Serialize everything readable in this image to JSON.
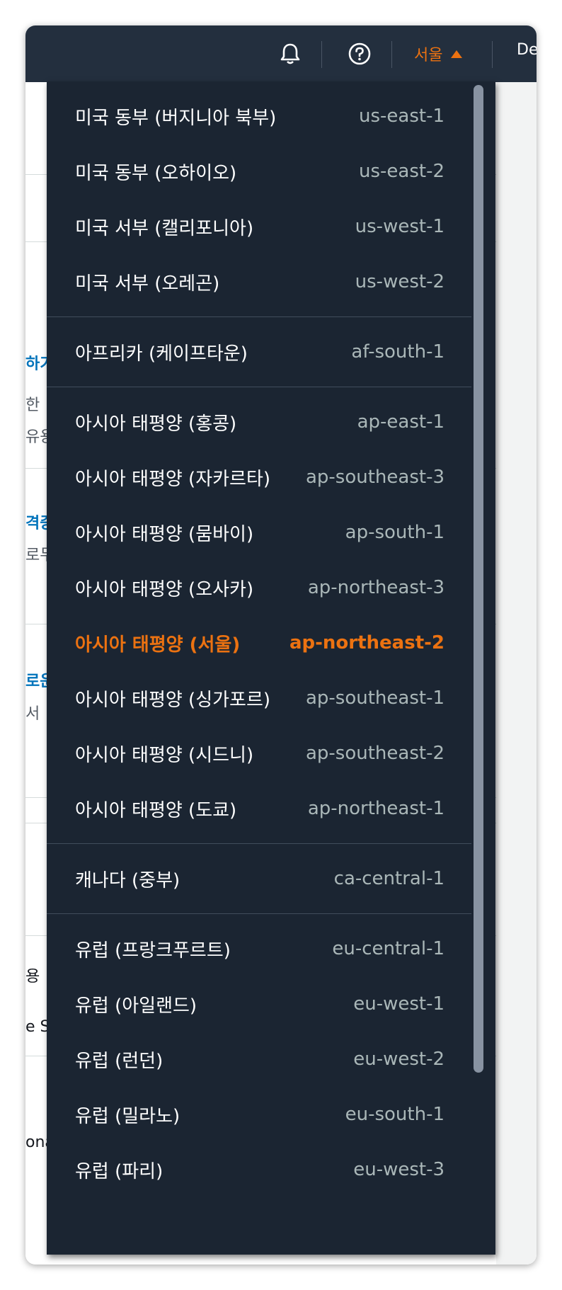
{
  "header": {
    "region_label": "서울",
    "account_label": "De"
  },
  "background": {
    "fragments": [
      "하기",
      "한",
      "유용",
      "격증",
      "로두",
      "로운",
      "서",
      "용",
      "e S",
      "ona"
    ]
  },
  "regions": [
    [
      {
        "name": "미국 동부 (버지니아 북부)",
        "code": "us-east-1"
      },
      {
        "name": "미국 동부 (오하이오)",
        "code": "us-east-2"
      },
      {
        "name": "미국 서부 (캘리포니아)",
        "code": "us-west-1"
      },
      {
        "name": "미국 서부 (오레곤)",
        "code": "us-west-2"
      }
    ],
    [
      {
        "name": "아프리카 (케이프타운)",
        "code": "af-south-1"
      }
    ],
    [
      {
        "name": "아시아 태평양 (홍콩)",
        "code": "ap-east-1"
      },
      {
        "name": "아시아 태평양 (자카르타)",
        "code": "ap-southeast-3"
      },
      {
        "name": "아시아 태평양 (뭄바이)",
        "code": "ap-south-1"
      },
      {
        "name": "아시아 태평양 (오사카)",
        "code": "ap-northeast-3"
      },
      {
        "name": "아시아 태평양 (서울)",
        "code": "ap-northeast-2",
        "selected": true
      },
      {
        "name": "아시아 태평양 (싱가포르)",
        "code": "ap-southeast-1"
      },
      {
        "name": "아시아 태평양 (시드니)",
        "code": "ap-southeast-2"
      },
      {
        "name": "아시아 태평양 (도쿄)",
        "code": "ap-northeast-1"
      }
    ],
    [
      {
        "name": "캐나다 (중부)",
        "code": "ca-central-1"
      }
    ],
    [
      {
        "name": "유럽 (프랑크푸르트)",
        "code": "eu-central-1"
      },
      {
        "name": "유럽 (아일랜드)",
        "code": "eu-west-1"
      },
      {
        "name": "유럽 (런던)",
        "code": "eu-west-2"
      },
      {
        "name": "유럽 (밀라노)",
        "code": "eu-south-1"
      },
      {
        "name": "유럽 (파리)",
        "code": "eu-west-3"
      }
    ]
  ],
  "colors": {
    "accent": "#ec7211",
    "menu_bg": "#1b2532",
    "topbar_bg": "#232f3e"
  }
}
